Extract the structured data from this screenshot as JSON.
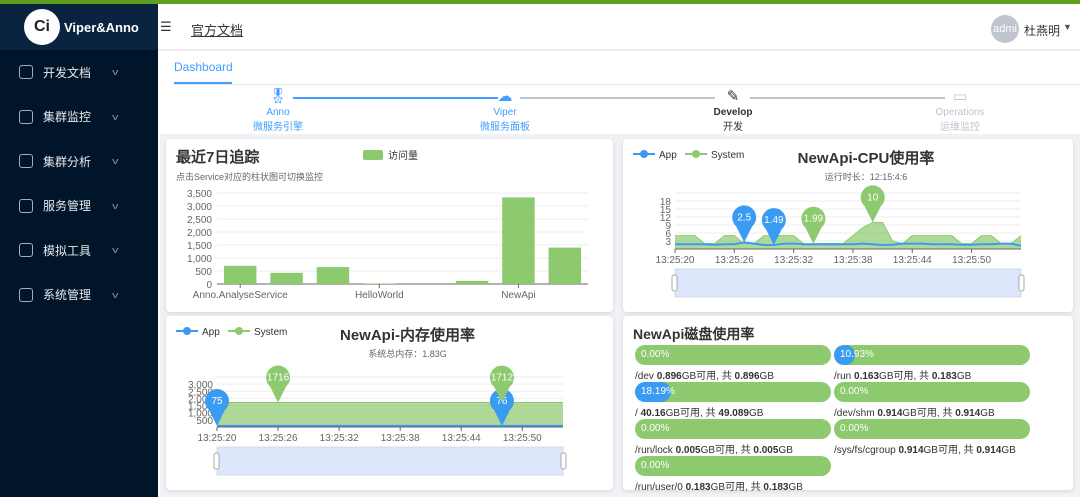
{
  "brand": {
    "name": "Viper&Anno",
    "logo_text": "Ci"
  },
  "sidebar": {
    "items": [
      {
        "label": "开发文档",
        "icon": "docs-icon"
      },
      {
        "label": "集群监控",
        "icon": "monitor-icon"
      },
      {
        "label": "集群分析",
        "icon": "analysis-icon"
      },
      {
        "label": "服务管理",
        "icon": "chip-icon"
      },
      {
        "label": "模拟工具",
        "icon": "tool-icon"
      },
      {
        "label": "系统管理",
        "icon": "gear-icon"
      }
    ]
  },
  "header": {
    "doc_link": "官方文档",
    "avatar_text": "admi",
    "username": "杜燕明"
  },
  "tabs": [
    {
      "label": "Dashboard",
      "active": true
    }
  ],
  "steps": [
    {
      "title": "Anno",
      "desc": "微服务引擎",
      "state": "done",
      "icon": "medal-icon"
    },
    {
      "title": "Viper",
      "desc": "微服务面板",
      "state": "done",
      "icon": "cloud-upload-icon"
    },
    {
      "title": "Develop",
      "desc": "开发",
      "state": "active",
      "icon": "pen-icon"
    },
    {
      "title": "Operations",
      "desc": "运维监控",
      "state": "pending",
      "icon": "monitor-icon"
    }
  ],
  "colors": {
    "accent": "#409eff",
    "green": "#8dc96e",
    "app": "#3a9bf2",
    "sidebar": "#001529"
  },
  "chart_data": [
    {
      "type": "bar",
      "title": "最近7日追踪",
      "subtitle": "点击Service对应的柱状图可切换监控",
      "legend": [
        "访问量"
      ],
      "categories": [
        "Anno.AnalyseService",
        "",
        "",
        "HelloWorld",
        "",
        "",
        "NewApi",
        ""
      ],
      "values": [
        700,
        430,
        650,
        20,
        0,
        120,
        3330,
        1400
      ],
      "ylim": [
        0,
        3500
      ],
      "yticks": [
        0,
        500,
        1000,
        1500,
        2000,
        2500,
        3000,
        3500
      ]
    },
    {
      "type": "area",
      "title": "NewApi-CPU使用率",
      "subtitle": "运行时长：12:15:4:6",
      "legend": [
        "App",
        "System"
      ],
      "x_ticks": [
        "13:25:20",
        "13:25:26",
        "13:25:32",
        "13:25:38",
        "13:25:44",
        "13:25:50"
      ],
      "yticks": [
        3,
        6,
        9,
        12,
        15,
        18
      ],
      "ylim": [
        0,
        21
      ],
      "series": [
        {
          "name": "App",
          "values": [
            1.8,
            1.8,
            1.8,
            1.8,
            1.6,
            1.8,
            1.8,
            2.5,
            2,
            1.5,
            1.49,
            2,
            2,
            1.8,
            1.8,
            1.8,
            1.8,
            1.8,
            1.8,
            2,
            1.8,
            1.5,
            1.6,
            2,
            2,
            2,
            1.8,
            1.8,
            1.8,
            1.6,
            1.6,
            1.8,
            1.8,
            2,
            2,
            1.2
          ],
          "markers": [
            {
              "i": 7,
              "label": "2.5"
            },
            {
              "i": 10,
              "label": "1.49"
            }
          ]
        },
        {
          "name": "System",
          "values": [
            5,
            5,
            5,
            2,
            2,
            5,
            5,
            2,
            2,
            5,
            5,
            5,
            5,
            2,
            1.99,
            2,
            2,
            2,
            5,
            8,
            10,
            10,
            3,
            2,
            5,
            5,
            5,
            5,
            5,
            2,
            2,
            5,
            5,
            2,
            2,
            5
          ],
          "markers": [
            {
              "i": 14,
              "label": "1.99"
            },
            {
              "i": 20,
              "label": "10"
            }
          ]
        }
      ]
    },
    {
      "type": "area",
      "title": "NewApi-内存使用率",
      "subtitle": "系统总内存：1.83G",
      "legend": [
        "App",
        "System"
      ],
      "x_ticks": [
        "13:25:20",
        "13:25:26",
        "13:25:32",
        "13:25:38",
        "13:25:44",
        "13:25:50"
      ],
      "yticks": [
        500,
        1000,
        1500,
        2000,
        2500,
        3000
      ],
      "ylim": [
        0,
        3500
      ],
      "series": [
        {
          "name": "App",
          "values": [
            75,
            75,
            75,
            75,
            75,
            75,
            75,
            75,
            75,
            75,
            75,
            75,
            75,
            75,
            75,
            75,
            75,
            75,
            75,
            75,
            75,
            75,
            75,
            75,
            75,
            75,
            75,
            75,
            76,
            76,
            76,
            76,
            76,
            76,
            76
          ],
          "markers": [
            {
              "i": 0,
              "label": "75"
            },
            {
              "i": 28,
              "label": "76"
            }
          ]
        },
        {
          "name": "System",
          "values": [
            1715,
            1715,
            1715,
            1715,
            1715,
            1715,
            1716,
            1715,
            1715,
            1715,
            1715,
            1715,
            1715,
            1715,
            1714,
            1714,
            1714,
            1714,
            1714,
            1714,
            1713,
            1713,
            1713,
            1713,
            1713,
            1713,
            1713,
            1713,
            1712,
            1712,
            1712,
            1712,
            1712,
            1712,
            1712
          ],
          "markers": [
            {
              "i": 6,
              "label": "1716"
            },
            {
              "i": 28,
              "label": "1712"
            }
          ]
        }
      ]
    }
  ],
  "disk": {
    "title": "NewApi磁盘使用率",
    "avail_label": "GB可用, 共",
    "unit": "GB",
    "items": [
      {
        "mount": "/dev",
        "pct": 0,
        "pct_label": "0.00%",
        "free": "0.896",
        "total": "0.896"
      },
      {
        "mount": "/run",
        "pct": 10.93,
        "pct_label": "10.93%",
        "free": "0.163",
        "total": "0.183"
      },
      {
        "mount": "/",
        "pct": 18.19,
        "pct_label": "18.19%",
        "free": "40.16",
        "total": "49.089"
      },
      {
        "mount": "/dev/shm",
        "pct": 0,
        "pct_label": "0.00%",
        "free": "0.914",
        "total": "0.914"
      },
      {
        "mount": "/run/lock",
        "pct": 0,
        "pct_label": "0.00%",
        "free": "0.005",
        "total": "0.005"
      },
      {
        "mount": "/sys/fs/cgroup",
        "pct": 0,
        "pct_label": "0.00%",
        "free": "0.914",
        "total": "0.914"
      },
      {
        "mount": "/run/user/0",
        "pct": 0,
        "pct_label": "0.00%",
        "free": "0.183",
        "total": "0.183"
      }
    ]
  }
}
